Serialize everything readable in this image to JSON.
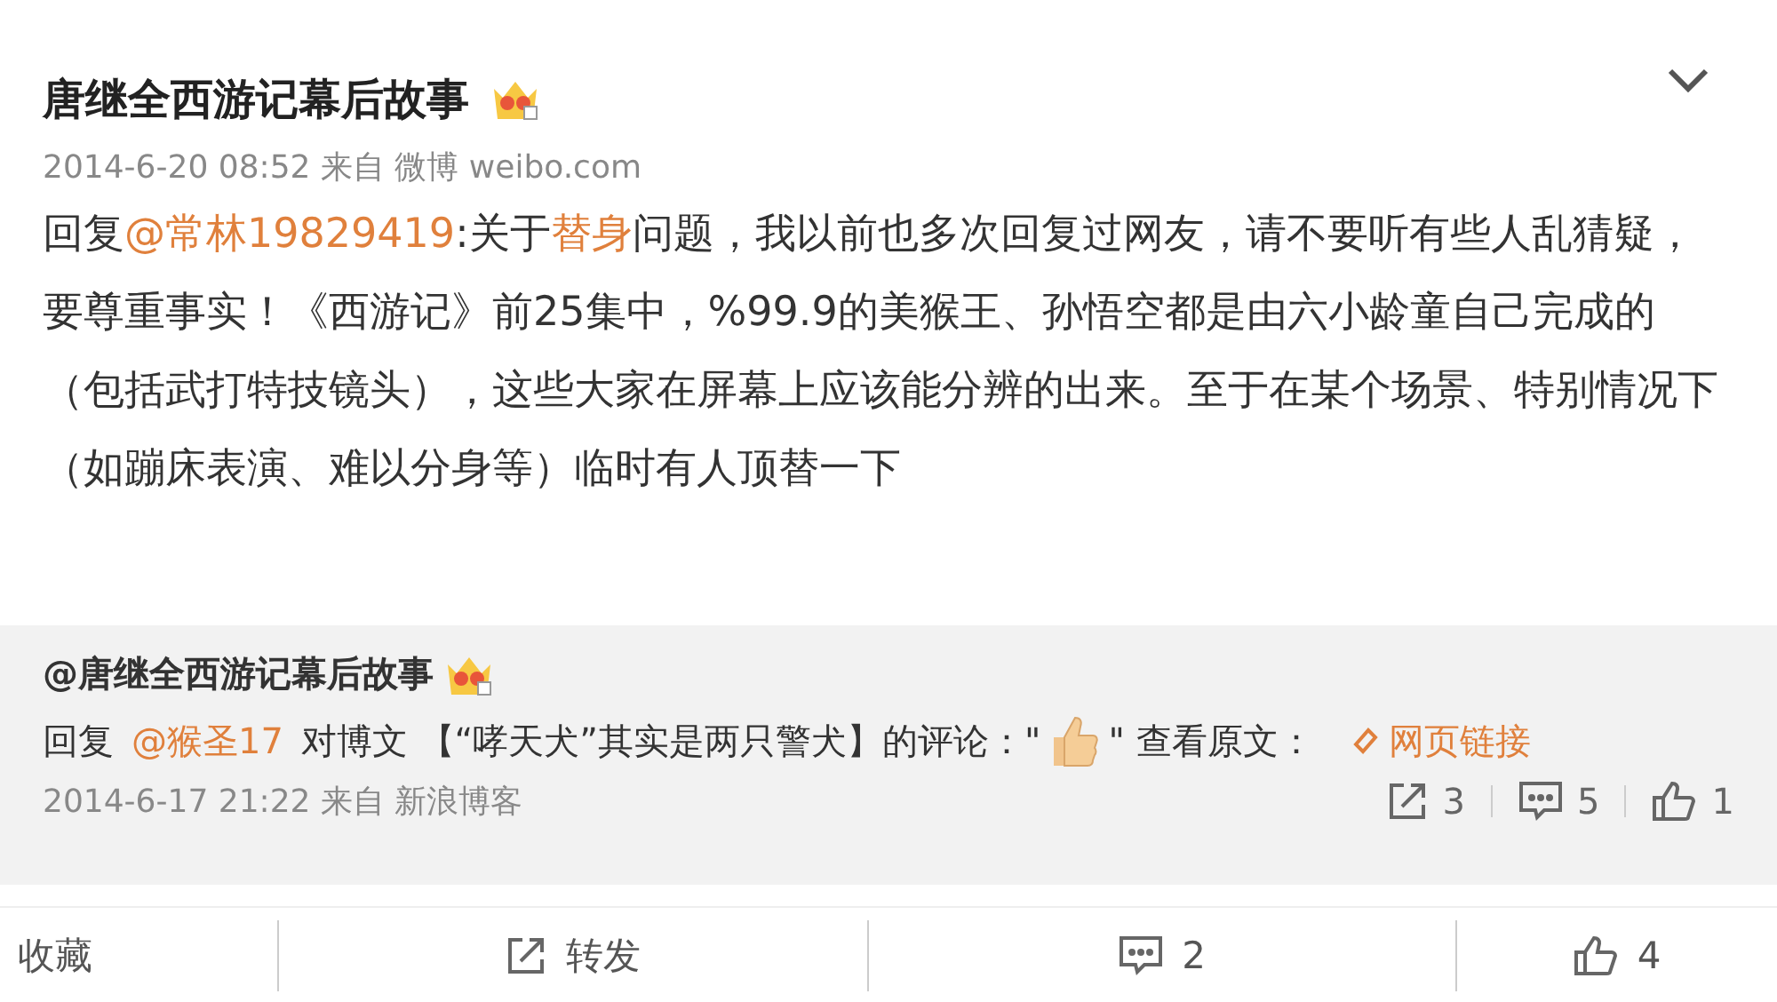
{
  "post": {
    "author": "唐继全西游记幕后故事",
    "meta": "2014-6-20 08:52 来自 微博 weibo.com",
    "body": [
      {
        "kind": "plain",
        "text": "回复"
      },
      {
        "kind": "mention",
        "text": "@常林19829419"
      },
      {
        "kind": "plain",
        "text": ":关于"
      },
      {
        "kind": "topic",
        "text": "替身"
      },
      {
        "kind": "plain",
        "text": "问题，我以前也多次回复过网友，请不要听有些人乱猜疑，要尊重事实！《西游记》前25集中，%99.9的美猴王、孙悟空都是由六小龄童自己完成的（包括武打特技镜头），这些大家在屏幕上应该能分辨的出来。至于在某个场景、特别情况下（如蹦床表演、难以分身等）临时有人顶替一下"
      }
    ]
  },
  "quoted": {
    "author": "@唐继全西游记幕后故事",
    "line": [
      {
        "kind": "plain",
        "text": "回复"
      },
      {
        "kind": "mention",
        "text": "@猴圣17"
      },
      {
        "kind": "plain",
        "text": "对博文 【“哮天犬”其实是两只警犬】的评论：\""
      },
      {
        "kind": "thumb"
      },
      {
        "kind": "plain",
        "text": "\" 查看原文："
      },
      {
        "kind": "weblink",
        "text": "网页链接"
      }
    ],
    "meta": "2014-6-17 21:22 来自 新浪博客",
    "stats": [
      {
        "kind": "share",
        "text": "3"
      },
      {
        "kind": "comment",
        "text": "5"
      },
      {
        "kind": "like",
        "text": "1"
      }
    ]
  },
  "actions": [
    {
      "kind": "favorite",
      "text": "收藏"
    },
    {
      "kind": "share",
      "text": "转发"
    },
    {
      "kind": "comment",
      "text": "2"
    },
    {
      "kind": "like",
      "text": "4"
    }
  ]
}
